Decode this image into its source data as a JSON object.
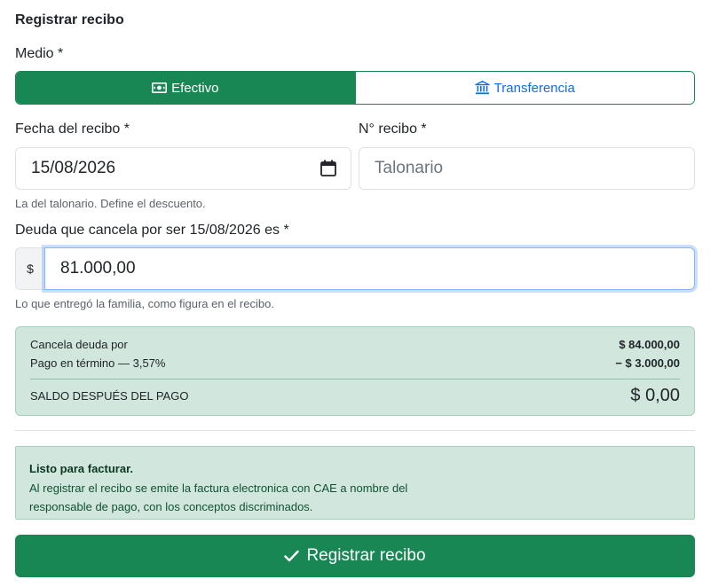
{
  "form": {
    "title": "Registrar recibo",
    "medio_label": "Medio *",
    "medio_options": [
      {
        "label": "Efectivo",
        "icon": "cash-icon",
        "selected": true
      },
      {
        "label": "Transferencia",
        "icon": "bank-icon",
        "selected": false
      }
    ],
    "fecha_label": "Fecha del recibo *",
    "fecha_value": "15/08/2026",
    "fecha_help": "La del talonario. Define el descuento.",
    "nro_label": "N° recibo *",
    "nro_placeholder": "Talonario",
    "deuda_label": "Deuda que cancela por ser 15/08/2026 es *",
    "currency_symbol": "$",
    "deuda_value": "81.000,00",
    "deuda_help": "Lo que entregó la familia, como figura en el recibo."
  },
  "summary": {
    "row1_label": "Cancela deuda por",
    "row1_value": "$ 84.000,00",
    "row2_label": "Pago en término — 3,57%",
    "row2_value": "− $ 3.000,00",
    "total_label": "SALDO DESPUÉS DEL PAGO",
    "total_value": "$ 0,00"
  },
  "alert": {
    "title": "Listo para facturar.",
    "text": "Al registrar el recibo se emite la factura electronica con CAE a nombre del responsable de pago, con los conceptos discriminados."
  },
  "submit": {
    "label": "Registrar recibo",
    "icon": "check-icon"
  },
  "colors": {
    "primary_green": "#198754",
    "link_blue": "#0d6efd",
    "success_bg": "#d1e7dd"
  }
}
